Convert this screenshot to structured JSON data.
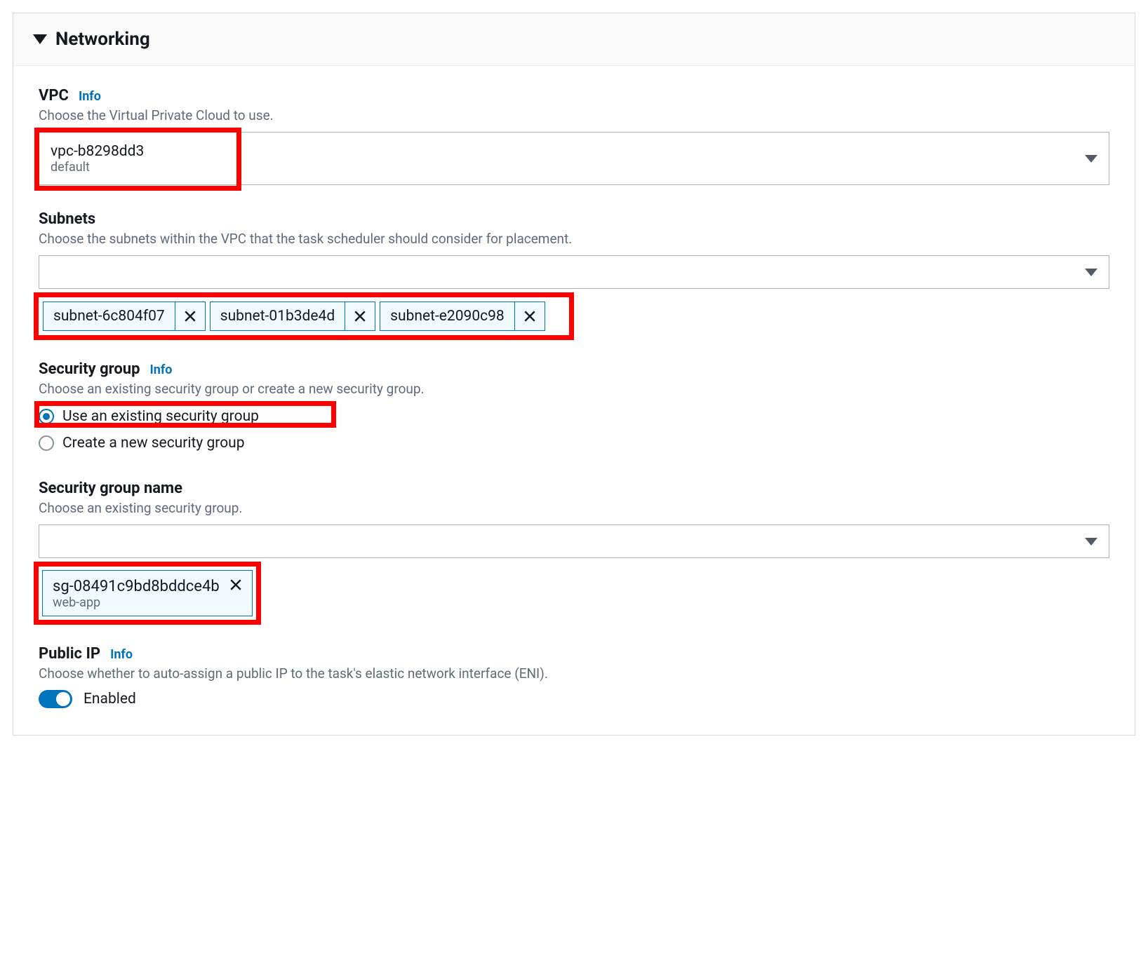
{
  "section": {
    "title": "Networking"
  },
  "info_label": "Info",
  "vpc": {
    "label": "VPC",
    "help": "Choose the Virtual Private Cloud to use.",
    "selected_id": "vpc-b8298dd3",
    "selected_name": "default"
  },
  "subnets": {
    "label": "Subnets",
    "help": "Choose the subnets within the VPC that the task scheduler should consider for placement.",
    "selected": [
      "subnet-6c804f07",
      "subnet-01b3de4d",
      "subnet-e2090c98"
    ]
  },
  "security_group": {
    "label": "Security group",
    "help": "Choose an existing security group or create a new security group.",
    "options": {
      "existing": "Use an existing security group",
      "create": "Create a new security group"
    },
    "selected": "existing"
  },
  "security_group_name": {
    "label": "Security group name",
    "help": "Choose an existing security group.",
    "selected_id": "sg-08491c9bd8bddce4b",
    "selected_name": "web-app"
  },
  "public_ip": {
    "label": "Public IP",
    "help": "Choose whether to auto-assign a public IP to the task's elastic network interface (ENI).",
    "status": "Enabled"
  }
}
